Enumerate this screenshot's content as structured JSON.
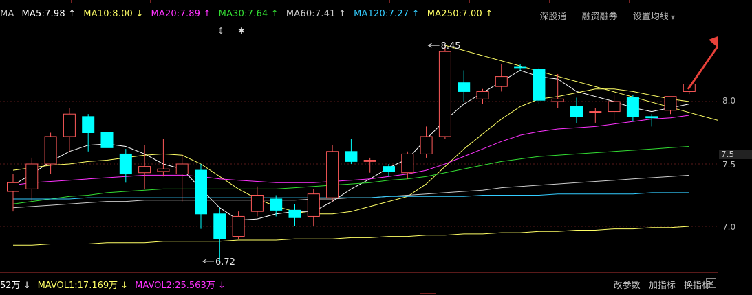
{
  "ma_legend": [
    {
      "label": "MA",
      "color": "#cfcfcf"
    },
    {
      "label": "MA5:7.98 ↑",
      "color": "#ffffff"
    },
    {
      "label": "MA10:8.00 ↓",
      "color": "#ffff66"
    },
    {
      "label": "MA20:7.89 ↑",
      "color": "#ff33ff"
    },
    {
      "label": "MA30:7.64 ↑",
      "color": "#33dd33"
    },
    {
      "label": "MA60:7.41 ↑",
      "color": "#cccccc"
    },
    {
      "label": "MA120:7.27 ↑",
      "color": "#33ccff"
    },
    {
      "label": "MA250:7.00 ↑",
      "color": "#ffff66"
    }
  ],
  "top_menu": [
    "深股通",
    "融资融券",
    "设置均线"
  ],
  "glyphs": [
    "⇕",
    "✱"
  ],
  "colors": {
    "up": "#ff5a5a",
    "down": "#00ffff",
    "bg": "#000000",
    "arrow": "#e8413a",
    "grid": "#5a1a1a"
  },
  "volume_legend": [
    {
      "label": "52万 ↓",
      "color": "#ffffff"
    },
    {
      "label": "MAVOL1:17.169万 ↓",
      "color": "#ffff66"
    },
    {
      "label": "MAVOL2:25.563万 ↓",
      "color": "#ff33ff"
    }
  ],
  "volume_menu": [
    "改参数",
    "加指标",
    "换指标"
  ],
  "close_glyph": "✕",
  "chart_data": {
    "type": "candlestick",
    "y_axis_ticks": [
      "8.0",
      "7.5",
      "7.0"
    ],
    "current_price_label": "7.5",
    "ylim": [
      6.6,
      8.6
    ],
    "annotations": [
      {
        "text": "8.45",
        "x_index": 22,
        "y": 8.45
      },
      {
        "text": "6.72",
        "x_index": 10,
        "y": 6.72
      }
    ],
    "candles": [
      {
        "o": 7.28,
        "h": 7.42,
        "l": 7.12,
        "c": 7.35
      },
      {
        "o": 7.3,
        "h": 7.55,
        "l": 7.2,
        "c": 7.5
      },
      {
        "o": 7.5,
        "h": 7.75,
        "l": 7.42,
        "c": 7.72
      },
      {
        "o": 7.72,
        "h": 7.95,
        "l": 7.6,
        "c": 7.9
      },
      {
        "o": 7.88,
        "h": 7.9,
        "l": 7.6,
        "c": 7.75
      },
      {
        "o": 7.75,
        "h": 7.78,
        "l": 7.55,
        "c": 7.63
      },
      {
        "o": 7.58,
        "h": 7.62,
        "l": 7.35,
        "c": 7.42
      },
      {
        "o": 7.43,
        "h": 7.65,
        "l": 7.3,
        "c": 7.48
      },
      {
        "o": 7.44,
        "h": 7.7,
        "l": 7.4,
        "c": 7.46
      },
      {
        "o": 7.42,
        "h": 7.58,
        "l": 7.2,
        "c": 7.5
      },
      {
        "o": 7.45,
        "h": 7.5,
        "l": 6.98,
        "c": 7.1
      },
      {
        "o": 7.1,
        "h": 7.15,
        "l": 6.72,
        "c": 6.9
      },
      {
        "o": 6.92,
        "h": 7.12,
        "l": 6.9,
        "c": 7.08
      },
      {
        "o": 7.12,
        "h": 7.32,
        "l": 7.08,
        "c": 7.25
      },
      {
        "o": 7.22,
        "h": 7.25,
        "l": 7.08,
        "c": 7.13
      },
      {
        "o": 7.13,
        "h": 7.18,
        "l": 7.0,
        "c": 7.07
      },
      {
        "o": 7.08,
        "h": 7.3,
        "l": 7.0,
        "c": 7.26
      },
      {
        "o": 7.23,
        "h": 7.65,
        "l": 7.2,
        "c": 7.6
      },
      {
        "o": 7.6,
        "h": 7.7,
        "l": 7.5,
        "c": 7.52
      },
      {
        "o": 7.52,
        "h": 7.55,
        "l": 7.43,
        "c": 7.53
      },
      {
        "o": 7.48,
        "h": 7.5,
        "l": 7.4,
        "c": 7.44
      },
      {
        "o": 7.43,
        "h": 7.6,
        "l": 7.38,
        "c": 7.58
      },
      {
        "o": 7.58,
        "h": 7.8,
        "l": 7.55,
        "c": 7.72
      },
      {
        "o": 7.72,
        "h": 8.45,
        "l": 7.7,
        "c": 8.4
      },
      {
        "o": 8.15,
        "h": 8.25,
        "l": 8.0,
        "c": 8.08
      },
      {
        "o": 8.02,
        "h": 8.1,
        "l": 7.98,
        "c": 8.08
      },
      {
        "o": 8.12,
        "h": 8.3,
        "l": 8.08,
        "c": 8.2
      },
      {
        "o": 8.28,
        "h": 8.3,
        "l": 8.25,
        "c": 8.27
      },
      {
        "o": 8.26,
        "h": 8.27,
        "l": 7.98,
        "c": 8.01
      },
      {
        "o": 8.0,
        "h": 8.22,
        "l": 7.95,
        "c": 8.02
      },
      {
        "o": 7.96,
        "h": 8.03,
        "l": 7.83,
        "c": 7.88
      },
      {
        "o": 7.92,
        "h": 7.95,
        "l": 7.83,
        "c": 7.92
      },
      {
        "o": 7.92,
        "h": 8.05,
        "l": 7.85,
        "c": 8.0
      },
      {
        "o": 8.03,
        "h": 8.05,
        "l": 7.84,
        "c": 7.88
      },
      {
        "o": 7.88,
        "h": 7.9,
        "l": 7.8,
        "c": 7.87
      },
      {
        "o": 7.93,
        "h": 8.04,
        "l": 7.9,
        "c": 8.04
      },
      {
        "o": 8.08,
        "h": 8.14,
        "l": 8.06,
        "c": 8.14
      }
    ],
    "ma_series": [
      {
        "color": "#ffffff",
        "values": [
          7.33,
          7.42,
          7.52,
          7.6,
          7.65,
          7.66,
          7.64,
          7.58,
          7.5,
          7.46,
          7.3,
          7.15,
          7.05,
          7.06,
          7.1,
          7.12,
          7.12,
          7.2,
          7.3,
          7.38,
          7.47,
          7.54,
          7.7,
          7.85,
          7.98,
          8.07,
          8.16,
          8.25,
          8.2,
          8.18,
          8.08,
          8.04,
          8.0,
          7.95,
          7.92,
          7.95,
          7.98
        ]
      },
      {
        "color": "#ffff66",
        "values": [
          7.45,
          7.47,
          7.49,
          7.5,
          7.52,
          7.53,
          7.55,
          7.57,
          7.58,
          7.57,
          7.5,
          7.4,
          7.3,
          7.22,
          7.16,
          7.12,
          7.1,
          7.1,
          7.12,
          7.16,
          7.2,
          7.24,
          7.34,
          7.48,
          7.62,
          7.74,
          7.86,
          7.96,
          8.02,
          8.04,
          8.07,
          8.1,
          8.1,
          8.08,
          8.05,
          8.02,
          8.0
        ]
      },
      {
        "color": "#ff33ff",
        "values": [
          7.33,
          7.35,
          7.36,
          7.37,
          7.38,
          7.39,
          7.4,
          7.41,
          7.41,
          7.41,
          7.4,
          7.38,
          7.37,
          7.36,
          7.35,
          7.35,
          7.35,
          7.36,
          7.37,
          7.38,
          7.4,
          7.42,
          7.45,
          7.5,
          7.56,
          7.62,
          7.68,
          7.73,
          7.76,
          7.78,
          7.79,
          7.8,
          7.82,
          7.84,
          7.86,
          7.87,
          7.89
        ]
      },
      {
        "color": "#33dd33",
        "values": [
          7.18,
          7.2,
          7.22,
          7.24,
          7.25,
          7.27,
          7.28,
          7.29,
          7.3,
          7.3,
          7.3,
          7.3,
          7.3,
          7.3,
          7.3,
          7.31,
          7.32,
          7.33,
          7.34,
          7.35,
          7.37,
          7.38,
          7.4,
          7.43,
          7.46,
          7.49,
          7.52,
          7.54,
          7.56,
          7.57,
          7.58,
          7.59,
          7.6,
          7.61,
          7.62,
          7.63,
          7.64
        ]
      },
      {
        "color": "#cccccc",
        "values": [
          7.15,
          7.16,
          7.17,
          7.18,
          7.19,
          7.2,
          7.2,
          7.21,
          7.21,
          7.21,
          7.21,
          7.21,
          7.21,
          7.21,
          7.21,
          7.21,
          7.22,
          7.22,
          7.23,
          7.23,
          7.24,
          7.25,
          7.26,
          7.27,
          7.28,
          7.29,
          7.31,
          7.32,
          7.33,
          7.34,
          7.35,
          7.36,
          7.37,
          7.38,
          7.39,
          7.4,
          7.41
        ]
      },
      {
        "color": "#33ccff",
        "values": [
          7.22,
          7.22,
          7.22,
          7.22,
          7.23,
          7.23,
          7.23,
          7.23,
          7.23,
          7.23,
          7.23,
          7.23,
          7.23,
          7.23,
          7.23,
          7.23,
          7.23,
          7.23,
          7.23,
          7.23,
          7.24,
          7.24,
          7.24,
          7.24,
          7.24,
          7.25,
          7.25,
          7.25,
          7.25,
          7.26,
          7.26,
          7.26,
          7.26,
          7.26,
          7.27,
          7.27,
          7.27
        ]
      },
      {
        "color": "#ffff66",
        "values": [
          6.85,
          6.85,
          6.86,
          6.86,
          6.86,
          6.87,
          6.87,
          6.87,
          6.88,
          6.88,
          6.88,
          6.88,
          6.89,
          6.89,
          6.89,
          6.9,
          6.9,
          6.9,
          6.91,
          6.91,
          6.92,
          6.92,
          6.93,
          6.93,
          6.94,
          6.94,
          6.95,
          6.95,
          6.96,
          6.96,
          6.97,
          6.97,
          6.98,
          6.98,
          6.99,
          6.99,
          7.0
        ]
      }
    ],
    "trendline": {
      "from_index": 23,
      "from_y": 8.45,
      "to_y": 7.85,
      "color": "#ffff66"
    }
  }
}
